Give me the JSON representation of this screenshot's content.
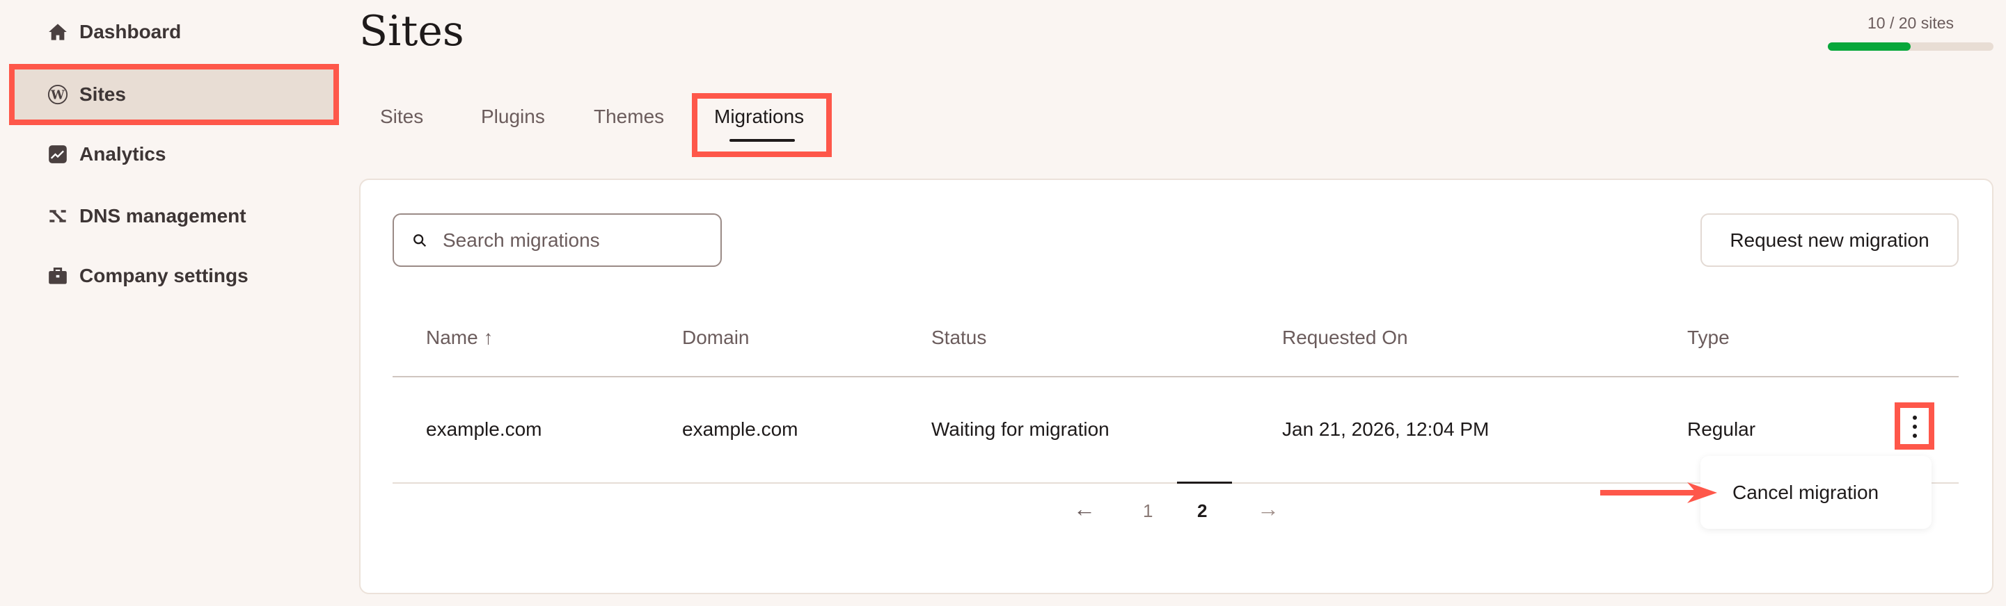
{
  "sidebar": {
    "items": [
      {
        "label": "Dashboard",
        "icon": "home-icon"
      },
      {
        "label": "Sites",
        "icon": "wordpress-icon",
        "selected": true
      },
      {
        "label": "Analytics",
        "icon": "analytics-icon"
      },
      {
        "label": "DNS management",
        "icon": "dns-icon"
      },
      {
        "label": "Company settings",
        "icon": "briefcase-icon"
      }
    ]
  },
  "header": {
    "title": "Sites",
    "usage": {
      "label": "10 / 20 sites",
      "used": 10,
      "total": 20,
      "color": "#07a73b"
    }
  },
  "tabs": [
    {
      "label": "Sites"
    },
    {
      "label": "Plugins"
    },
    {
      "label": "Themes"
    },
    {
      "label": "Migrations",
      "active": true
    }
  ],
  "search": {
    "placeholder": "Search migrations"
  },
  "request_button": "Request new migration",
  "table": {
    "columns": [
      "Name ↑",
      "Domain",
      "Status",
      "Requested On",
      "Type"
    ],
    "rows": [
      [
        "example.com",
        "example.com",
        "Waiting for migration",
        "Jan 21, 2026, 12:04 PM",
        "Regular"
      ]
    ]
  },
  "pagination": {
    "prev": "←",
    "pages": [
      "1",
      "2"
    ],
    "current": "2",
    "next": "→"
  },
  "menu": {
    "items": [
      "Cancel migration"
    ]
  },
  "highlight_color": "#fe574a"
}
